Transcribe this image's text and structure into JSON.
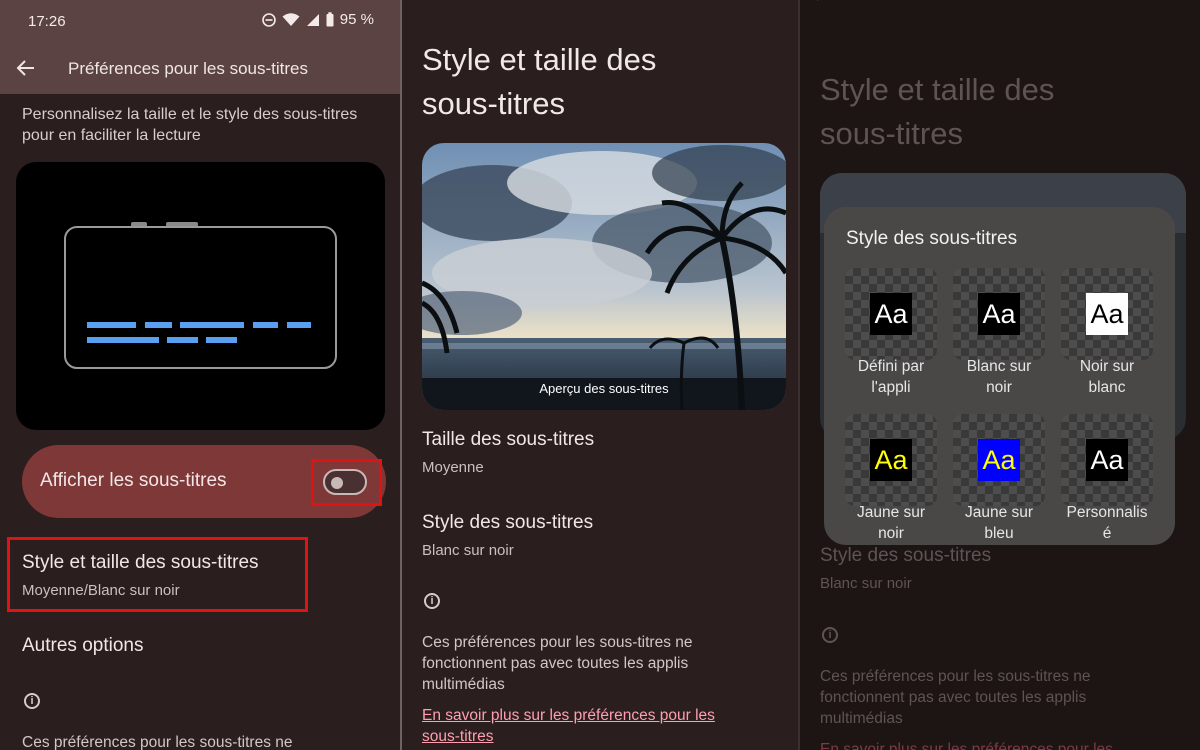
{
  "status": {
    "time": "17:26",
    "battery": "95 %"
  },
  "panel1": {
    "appbar_title": "Préférences pour les sous-titres",
    "intro": "Personnalisez la taille et le style des sous-titres pour en faciliter la lecture",
    "toggle_label": "Afficher les sous-titres",
    "toggle_on": false,
    "style_item": {
      "title": "Style et taille des sous-titres",
      "subtitle": "Moyenne/Blanc sur noir"
    },
    "more_options": "Autres options",
    "note": "Ces préférences pour les sous-titres ne"
  },
  "panel2": {
    "title_line1": "Style et taille des",
    "title_line2": "sous-titres",
    "preview_caption": "Aperçu des sous-titres",
    "size_title": "Taille des sous-titres",
    "size_value": "Moyenne",
    "style_title": "Style des sous-titres",
    "style_value": "Blanc sur noir",
    "note_line1": "Ces préférences pour les sous-titres ne",
    "note_line2": "fonctionnent pas avec toutes les applis",
    "note_line3": "multimédias",
    "link_line1": "En savoir plus sur les préférences pour les",
    "link_line2": "sous-titres"
  },
  "panel3": {
    "title_line1": "Style et taille des",
    "title_line2": "sous-titres",
    "style_title": "Style des sous-titres",
    "style_value": "Blanc sur noir",
    "note_line1": "Ces préférences pour les sous-titres ne",
    "note_line2": "fonctionnent pas avec toutes les applis",
    "note_line3": "multimédias",
    "link_line1": "En savoir plus sur les préférences pour les",
    "dialog": {
      "title": "Style des sous-titres",
      "sample": "Aa",
      "options": [
        {
          "line1": "Défini par",
          "line2": "l'appli",
          "fg": "#ffffff",
          "bg": "#000000"
        },
        {
          "line1": "Blanc sur",
          "line2": "noir",
          "fg": "#ffffff",
          "bg": "#000000"
        },
        {
          "line1": "Noir sur",
          "line2": "blanc",
          "fg": "#000000",
          "bg": "#ffffff"
        },
        {
          "line1": "Jaune sur",
          "line2": "noir",
          "fg": "#ffff00",
          "bg": "#000000"
        },
        {
          "line1": "Jaune sur",
          "line2": "bleu",
          "fg": "#ffff00",
          "bg": "#0000ff"
        },
        {
          "line1": "Personnalis",
          "line2": "é",
          "fg": "#ffffff",
          "bg": "#000000"
        }
      ]
    }
  },
  "colors": {
    "highlight": "#e01212",
    "toggle_card": "#7e3838",
    "link": "#ff9fb0",
    "caption_bar": "#5aa0f0"
  }
}
